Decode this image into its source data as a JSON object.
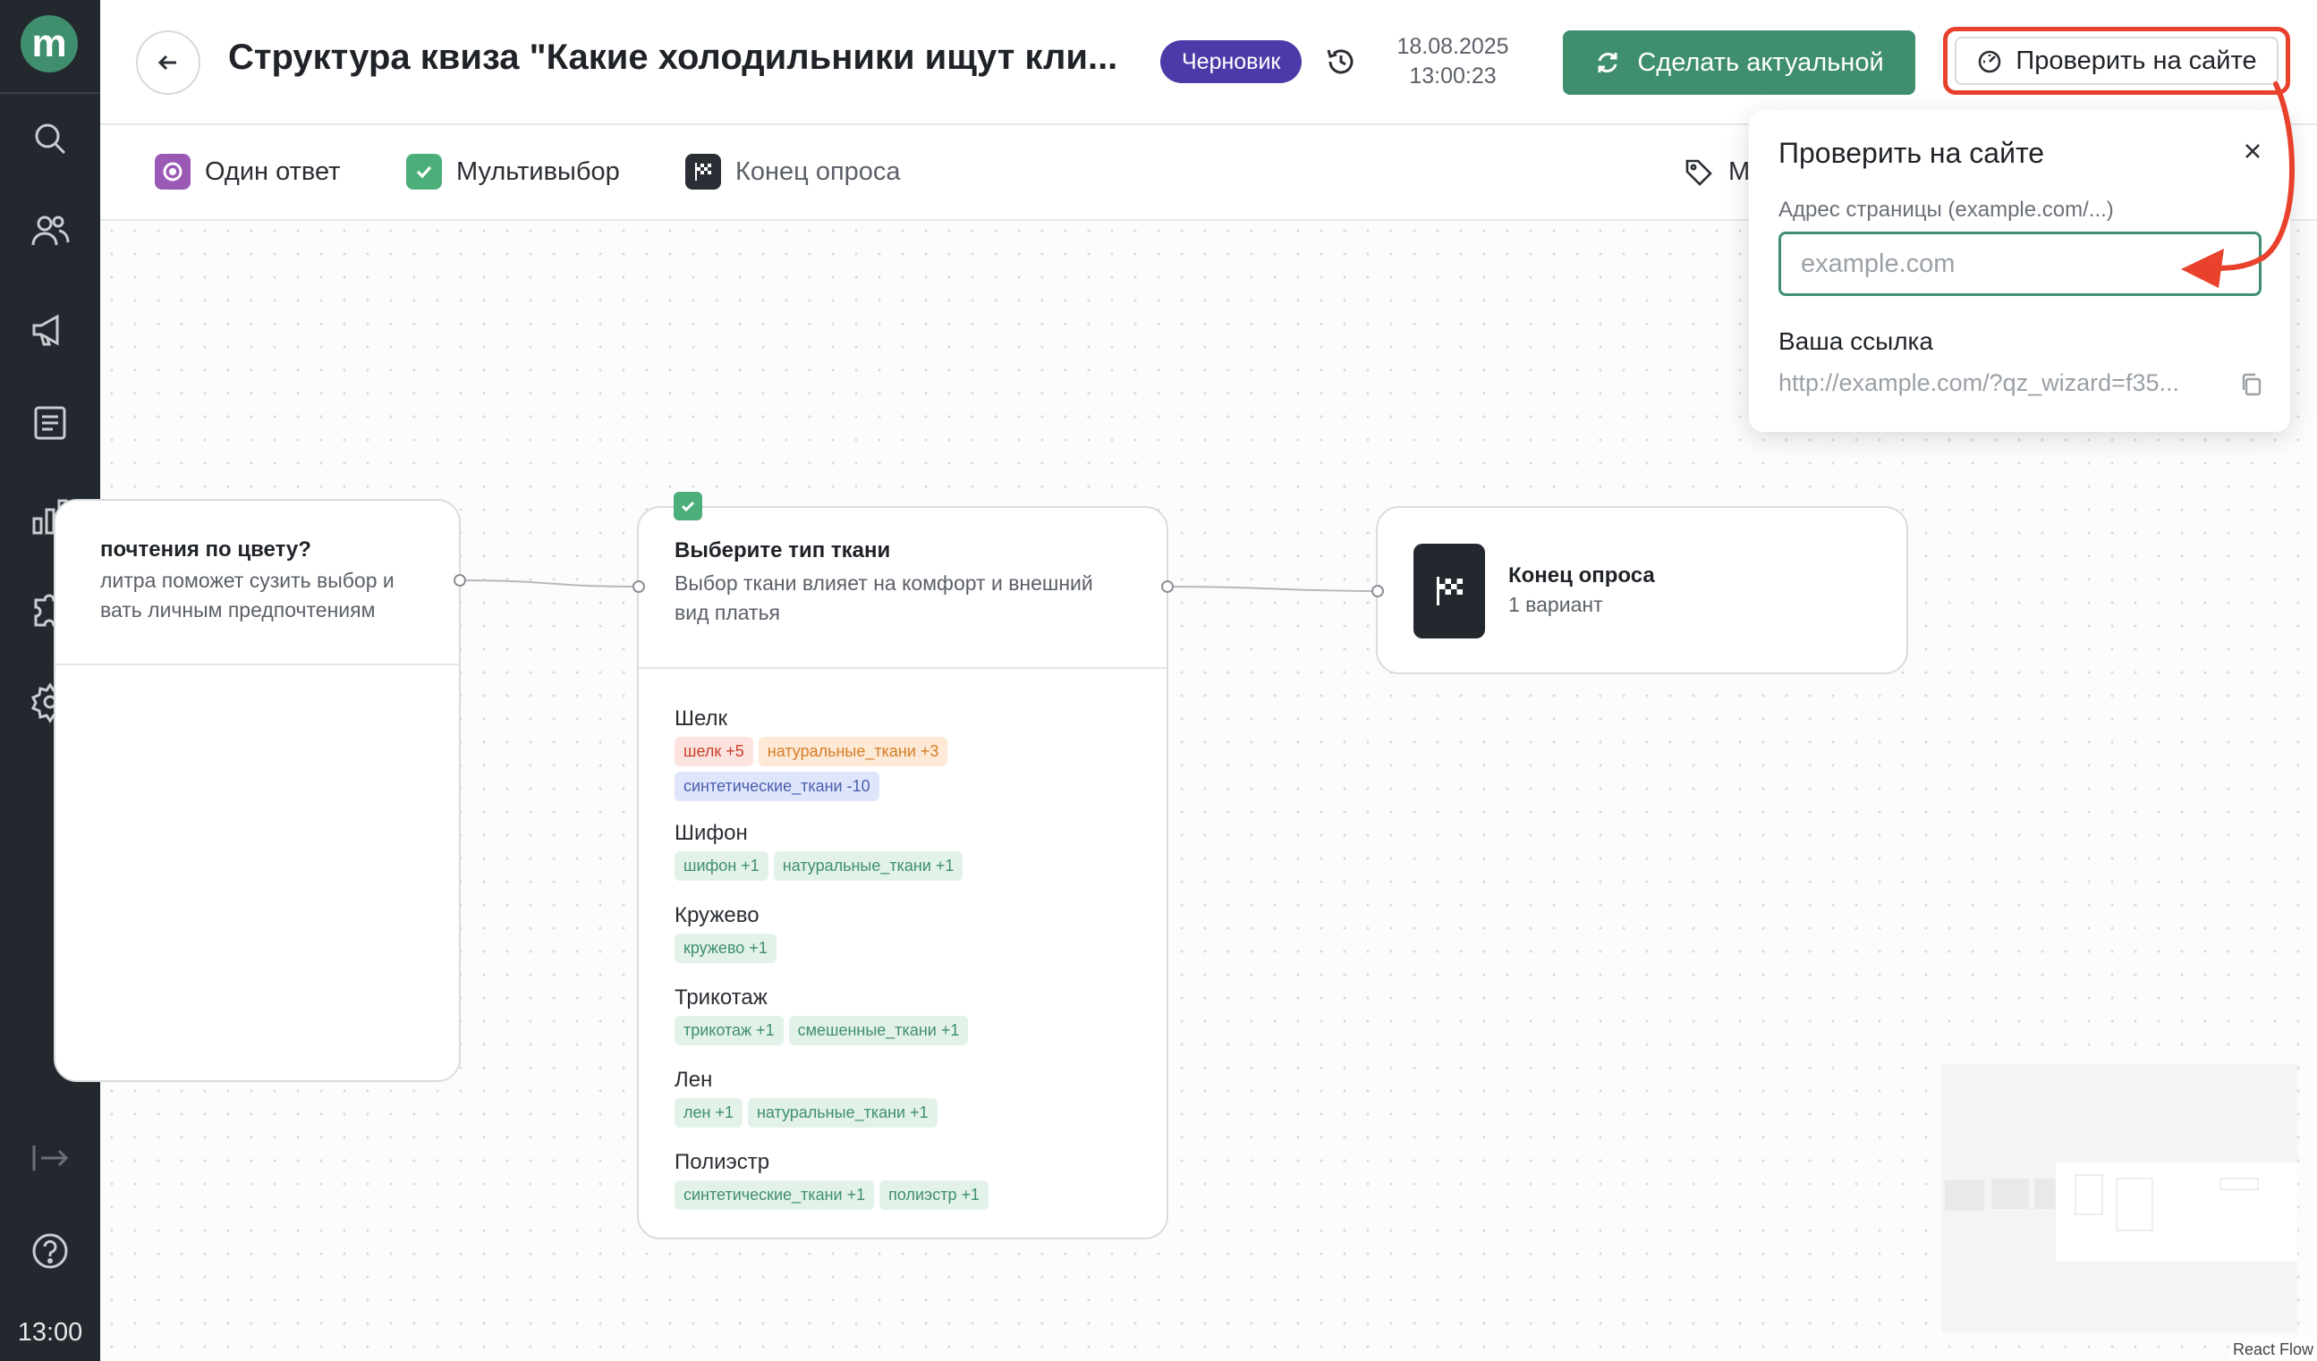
{
  "app": {
    "logo_letter": "m",
    "clock": "13:00"
  },
  "header": {
    "title": "Структура квиза \"Какие холодильники ищут кли...",
    "status_badge": "Черновик",
    "date": "18.08.2025",
    "time": "13:00:23",
    "make_actual_label": "Сделать актуальной",
    "check_site_label": "Проверить на сайте"
  },
  "toolbar": {
    "items": [
      {
        "label": "Один ответ",
        "icon": "radio-icon",
        "color": "#9b59b6"
      },
      {
        "label": "Мультивыбор",
        "icon": "check-icon",
        "color": "#4caf7a"
      },
      {
        "label": "Конец опроса",
        "icon": "finish-flag-icon",
        "color": "#2b2f35"
      }
    ],
    "partial_item_label": "М"
  },
  "nodes": {
    "left": {
      "title": "почтения по цвету?",
      "desc_line1": "литра поможет сузить выбор и",
      "desc_line2": "вать личным предпочтениям"
    },
    "fabric": {
      "title": "Выберите тип ткани",
      "desc": "Выбор ткани влияет на комфорт и внешний вид платья",
      "options": [
        {
          "label": "Шелк",
          "tags": [
            {
              "text": "шелк +5",
              "tone": "red"
            },
            {
              "text": "натуральные_ткани +3",
              "tone": "orange"
            },
            {
              "text": "синтетические_ткани -10",
              "tone": "blue"
            }
          ]
        },
        {
          "label": "Шифон",
          "tags": [
            {
              "text": "шифон +1",
              "tone": "green"
            },
            {
              "text": "натуральные_ткани +1",
              "tone": "green"
            }
          ]
        },
        {
          "label": "Кружево",
          "tags": [
            {
              "text": "кружево +1",
              "tone": "green"
            }
          ]
        },
        {
          "label": "Трикотаж",
          "tags": [
            {
              "text": "трикотаж +1",
              "tone": "green"
            },
            {
              "text": "смешенные_ткани +1",
              "tone": "green"
            }
          ]
        },
        {
          "label": "Лен",
          "tags": [
            {
              "text": "лен +1",
              "tone": "green"
            },
            {
              "text": "натуральные_ткани +1",
              "tone": "green"
            }
          ]
        },
        {
          "label": "Полиэстр",
          "tags": [
            {
              "text": "синтетические_ткани +1",
              "tone": "green"
            },
            {
              "text": "полиэстр +1",
              "tone": "green"
            }
          ]
        }
      ]
    },
    "end": {
      "title": "Конец опроса",
      "subtitle": "1 вариант"
    }
  },
  "popup": {
    "title": "Проверить на сайте",
    "field_label": "Адрес страницы (example.com/...)",
    "input_placeholder": "example.com",
    "input_value": "",
    "link_title": "Ваша ссылка",
    "link_value": "http://example.com/?qz_wizard=f35..."
  },
  "footer": {
    "attribution": "React Flow"
  },
  "colors": {
    "accent": "#3f8f6e",
    "highlight": "#e8412c",
    "badge": "#4b3ba8",
    "sidebar": "#23272e"
  }
}
